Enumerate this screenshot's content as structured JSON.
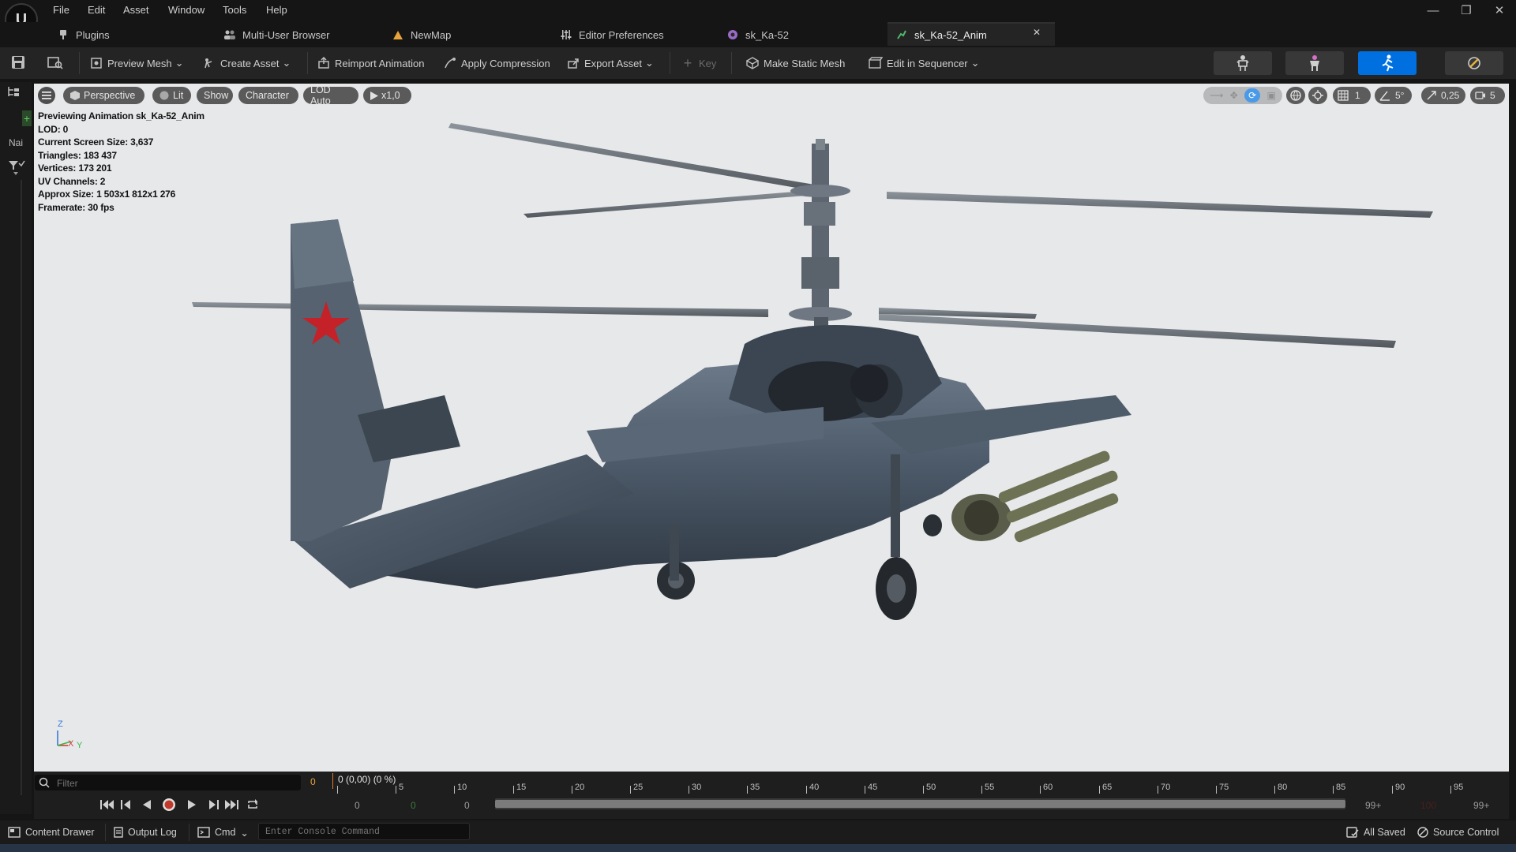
{
  "menu": [
    "File",
    "Edit",
    "Asset",
    "Window",
    "Tools",
    "Help"
  ],
  "window_controls": [
    "minimize-icon",
    "restore-icon",
    "close-icon"
  ],
  "tabs": [
    {
      "label": "Plugins",
      "icon": "plug-icon"
    },
    {
      "label": "Multi-User Browser",
      "icon": "users-icon"
    },
    {
      "label": "NewMap",
      "icon": "map-icon"
    },
    {
      "label": "Editor Preferences",
      "icon": "sliders-icon"
    },
    {
      "label": "sk_Ka-52",
      "icon": "skeleton-icon"
    },
    {
      "label": "sk_Ka-52_Anim",
      "icon": "anim-icon",
      "active": true
    }
  ],
  "toolbar": {
    "items": [
      {
        "label": "Preview Mesh",
        "dropdown": true
      },
      {
        "label": "Create Asset",
        "dropdown": true
      },
      {
        "label": "Reimport Animation"
      },
      {
        "label": "Apply Compression"
      },
      {
        "label": "Export Asset",
        "dropdown": true
      },
      {
        "label": "Key",
        "disabled": true
      },
      {
        "label": "Make Static Mesh"
      },
      {
        "label": "Edit in Sequencer",
        "dropdown": true
      }
    ],
    "modes": [
      "skeleton-mode",
      "mesh-mode",
      "animation-mode",
      "physics-mode"
    ],
    "active_mode": "animation-mode",
    "accent_color": "#0070e0"
  },
  "left_strip": {
    "label": "Nai"
  },
  "viewport": {
    "pills": [
      "Perspective",
      "Lit",
      "Show",
      "Character",
      "LOD Auto",
      "x1,0"
    ],
    "info": [
      "Previewing Animation sk_Ka-52_Anim",
      "LOD: 0",
      "Current Screen Size: 3,637",
      "Triangles: 183 437",
      "Vertices: 173 201",
      "UV Channels: 2",
      "Approx Size: 1 503x1 812x1 276",
      "Framerate: 30 fps"
    ],
    "right": {
      "grid_value": "1",
      "angle_value": "5°",
      "scale_value": "0,25",
      "camera_value": "5"
    },
    "axis": {
      "z": "Z",
      "x": "X",
      "y": "Y"
    },
    "background_color": "#e6e8ea"
  },
  "timeline": {
    "filter_placeholder": "Filter",
    "filter_count": "0",
    "position_text": "0 (0,00) (0 %)",
    "ticks": [
      "0",
      "5",
      "10",
      "15",
      "20",
      "25",
      "30",
      "35",
      "40",
      "45",
      "50",
      "55",
      "60",
      "65",
      "70",
      "75",
      "80",
      "85",
      "90",
      "95"
    ],
    "start_values": [
      "0",
      "0",
      "0"
    ],
    "end_values": [
      "99+",
      "100",
      "99+"
    ]
  },
  "statusbar": {
    "content_drawer": "Content Drawer",
    "output_log": "Output Log",
    "cmd": "Cmd",
    "console_placeholder": "Enter Console Command",
    "all_saved": "All Saved",
    "source_control": "Source Control"
  }
}
